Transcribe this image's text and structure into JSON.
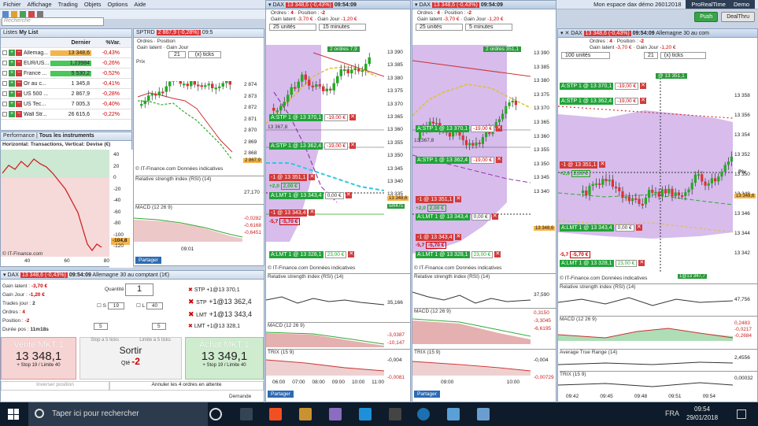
{
  "menu": [
    "Fichier",
    "Affichage",
    "Trading",
    "Objets",
    "Options",
    "Aide"
  ],
  "account_title": "Mon espace dax démo 26012018",
  "brand": "ProRealTime",
  "brand_suffix": "Demo",
  "push_button": "Push",
  "dealthru_button": "DealThru",
  "search_placeholder": "Recherche",
  "watchlist": {
    "tab": "Listes",
    "name": "My List",
    "col_last": "Dernier",
    "col_var": "%Var.",
    "rows": [
      {
        "name": "Allemag...",
        "price": "13 348,6",
        "var": "-0,43%",
        "color": "#f5b44a"
      },
      {
        "name": "EUR/US...",
        "price": "1,23984",
        "var": "-0,26%",
        "color": "#4ac65a"
      },
      {
        "name": "France ...",
        "price": "5 530,2",
        "var": "-0,52%",
        "color": "#4ac65a"
      },
      {
        "name": "Or au c...",
        "price": "1 345,8",
        "var": "-0,41%",
        "color": "#ffffff"
      },
      {
        "name": "US 500 ...",
        "price": "2 867,9",
        "var": "-0,28%",
        "color": "#ffffff"
      },
      {
        "name": "US Tec...",
        "price": "7 005,3",
        "var": "-0,40%",
        "color": "#ffffff"
      },
      {
        "name": "Wall Str...",
        "price": "26 615,6",
        "var": "-0,22%",
        "color": "#ffffff"
      }
    ]
  },
  "perf": {
    "tab": "Performance",
    "tab2": "Tous les instruments",
    "title": "Horizontal: Transactions, Vertical: Devise (€)",
    "yticks": [
      "40",
      "20",
      "0",
      "-20",
      "-40",
      "-60",
      "-80",
      "-100",
      "-120"
    ],
    "xticks": [
      "40",
      "60",
      "80"
    ],
    "val1": "-104,8",
    "footer": "© IT-Finance.com"
  },
  "spx": {
    "title": "SPTRD",
    "price": "2 867,9 (-0,28%)",
    "time": "09:5",
    "orders_label": "Ordres",
    "position_label": "Position",
    "gain_label": "Gain latent",
    "gainjour_label": "Gain Jour",
    "units": "21",
    "interval": "(x) ticks",
    "prix": "Prix",
    "yticks": [
      "2 874",
      "2 873",
      "2 872",
      "2 871",
      "2 870",
      "2 869",
      "2 868"
    ],
    "badge": "2 867,9",
    "footer": "© IT-Finance.com Données indicatives",
    "rsi": "Relative strength index (RSI) (14)",
    "rsi_val": "27,170",
    "macd": "MACD (12 26 9)",
    "macd_vals": [
      "-0,0282",
      "-0,6168",
      "-0,6451"
    ],
    "xtick": "09:01",
    "share": "Partager"
  },
  "dax1": {
    "title": "DAX",
    "price": "13 348,6 (-0,43%)",
    "time": "09:54:09",
    "orders": "4",
    "position": "-2",
    "gain_latent": "-3,70 €",
    "gain_jour": "-1,20 €",
    "units": "25 unités",
    "interval": "15 minutes",
    "orders_badge": "2 ordres",
    "orders_badge_val": "7,9",
    "yticks": [
      "13 390",
      "13 385",
      "13 380",
      "13 375",
      "13 370",
      "13 365",
      "13 360",
      "13 355",
      "13 350",
      "13 345",
      "13 340",
      "13 335"
    ],
    "stp1": "A:STP 1 @ 13 370,1",
    "stp1_pnl": "-19,00 €",
    "stp2": "A:STP 1 @ 13 362,4",
    "stp2_pnl": "-19,00 €",
    "pos1": "-1 @ 13 351,1",
    "pos1_pnl": "+2,0",
    "pos1_pnl2": "2,00 €",
    "lmt1": "A:LMT 1 @ 13 343,4",
    "lmt1_pnl": "0,00 €",
    "pos2": "-1 @ 13 343,4",
    "pos2_pnl": "-5,7",
    "pos2_pnl2": "-5,70 €",
    "lmt2": "A:LMT 1 @ 13 328,1",
    "lmt2_pnl": "23,00 €",
    "price_tag": "13 348,6",
    "price_tag2": "5m47s",
    "label_367": "13 367,8",
    "footer": "© IT-Finance.com Données indicatives",
    "rsi": "Relative strength index (RSI) (14)",
    "rsi_val": "35,166",
    "macd": "MACD (12 26 9)",
    "macd_vals": [
      "-3,0387",
      "-10,147"
    ],
    "trix": "TRIX (15 9)",
    "trix_vals": [
      "-0,004",
      "-0,0081"
    ],
    "xticks": [
      "06:00",
      "07:00",
      "08:00",
      "09:00",
      "10:00",
      "11:00"
    ],
    "share": "Partager"
  },
  "dax2": {
    "title": "DAX",
    "price": "13 348,6 (-0,43%)",
    "time": "09:54:09",
    "orders": "4",
    "position": "-2",
    "gain_latent": "-3,70 €",
    "gain_jour": "-1,20 €",
    "units": "25 unités",
    "interval": "5 minutes",
    "orders_badge": "2 ordres",
    "orders_badge_val": "351,1",
    "yticks": [
      "13 390",
      "13 385",
      "13 380",
      "13 375",
      "13 370",
      "13 365",
      "13 360",
      "13 355",
      "13 350",
      "13 345",
      "13 340"
    ],
    "stp1": "A:STP 1 @ 13 370,1",
    "stp2": "A:STP 1 @ 13 362,4",
    "pos1": "-1 @ 13 351,1",
    "lmt1": "A:LMT 1 @ 13 343,4",
    "pos2": "-1 @ 13 343,4",
    "lmt2": "A:LMT 1 @ 13 328,1",
    "price_tag": "13 348,6",
    "label_367": "13 367,8",
    "footer": "© IT-Finance.com Données indicatives",
    "rsi": "Relative strength index (RSI) (14)",
    "rsi_val": "37,590",
    "macd": "MACD (12 26 9)",
    "macd_vals": [
      "0,3150",
      "-3,3045",
      "-6,6195"
    ],
    "trix": "TRIX (15 9)",
    "trix_vals": [
      "-0,004",
      "-0,00729"
    ],
    "xticks": [
      "09:00",
      "10:00"
    ],
    "share": "Partager"
  },
  "dax3": {
    "title": "DAX",
    "price": "13 348,6 (-0,43%)",
    "time": "09:54:09",
    "subtitle": "Allemagne 30 au com",
    "orders": "4",
    "position": "-2",
    "gain_latent": "-3,70 €",
    "gain_jour": "-1,20 €",
    "units": "100 unités",
    "interval": "(x) ticks",
    "units2": "21",
    "yticks": [
      "13 358",
      "13 356",
      "13 354",
      "13 352",
      "13 350",
      "13 348",
      "13 346",
      "13 344",
      "13 342"
    ],
    "stp1": "A:STP 1 @ 13 370,1",
    "stp1_pnl": "-19,00 €",
    "stp2": "A:STP 1 @ 13 362,4",
    "stp2_pnl": "-19,00 €",
    "pos1": "-1 @ 13 351,1",
    "pos1_pnl": "+2,0",
    "pos1_pnl2": "2,00 €",
    "lmt1": "A:LMT 1 @ 13 343,4",
    "lmt1_pnl": "0,00 €",
    "pos2": "-5,7",
    "pos2_pnl2": "-5,70 €",
    "lmt2": "A:LMT 1 @ 13 328,1",
    "lmt2_pnl": "23,00 €",
    "top_tag": "@ 13 351,1",
    "bottom_tag": "1@13 347,7",
    "price_tag": "13 348,6",
    "pivot": "Piv",
    "footer": "© IT-Finance.com Données indicatives",
    "rsi": "Relative strength index (RSI) (14)",
    "rsi_val": "47,756",
    "macd": "MACD (12 26 9)",
    "macd_vals": [
      "0,2483",
      "-0,0217",
      "-0,2684"
    ],
    "atr": "Average True Range (14)",
    "atr_val": "2,4556",
    "trix": "TRIX (15 9)",
    "trix_val": "0,00032",
    "xticks": [
      "09:42",
      "09:45",
      "09:48",
      "09:51",
      "09:54"
    ],
    "share": "Partager"
  },
  "ticket": {
    "title": "DAX",
    "price": "13 348,6 (-0,43%)",
    "time": "09:54:09",
    "name": "Allemagne 30 au comptant (1€)",
    "gain_latent_label": "Gain latent :",
    "gain_latent": "-3,70 €",
    "gain_jour_label": "Gain Jour :",
    "gain_jour": "-1,20 €",
    "trades_label": "Trades jour :",
    "trades": "2",
    "orders_label": "Ordres :",
    "orders": "4",
    "position_label": "Position :",
    "position": "-2",
    "duration_label": "Durée pos :",
    "duration": "11m18s",
    "quantity_label": "Quantité",
    "quantity": "1",
    "s_label": "S",
    "s_value": "19",
    "l_label": "L",
    "l_value": "40",
    "field5a": "5",
    "field5b": "5",
    "stp1": "STP +1@13 370,1",
    "stp2_a": "STP",
    "stp2_b": "+1@13 362,4",
    "lmt1_a": "LMT",
    "lmt1_b": "+1@13 343,4",
    "lmt2": "LMT +1@13 328,1",
    "sell_label": "Vente MKT 1",
    "sell_price": "13 348,1",
    "sell_sub": "+ Stop 19 / Limite 40",
    "stop_ticks": "Stop à 5 ticks",
    "limit_ticks": "Limite à 5 ticks",
    "exit_label": "Sortir",
    "qty_label": "Qté",
    "qty_value": "-2",
    "buy_label": "Achat MKT 1",
    "buy_price": "13 349,1",
    "buy_sub": "+ Stop 19 / Limite 40",
    "reverse": "Inverser position",
    "cancel_all": "Annuler les 4 ordres en attente",
    "demande": "Demande"
  },
  "taskbar": {
    "search": "Taper ici pour rechercher",
    "lang": "FRA",
    "time": "09:54",
    "date": "29/01/2018"
  }
}
